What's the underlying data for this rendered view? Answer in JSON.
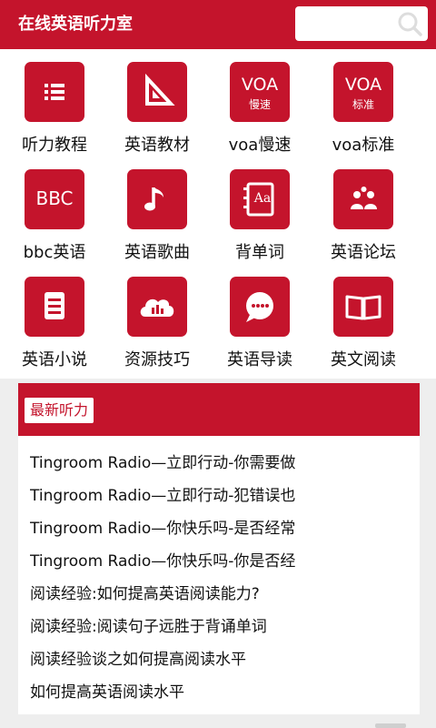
{
  "header": {
    "title": "在线英语听力室",
    "search_placeholder": "",
    "search_icon": "search-icon"
  },
  "menu": [
    {
      "label": "听力教程",
      "icon": "list-icon"
    },
    {
      "label": "英语教材",
      "icon": "triangle-ruler-icon"
    },
    {
      "label": "voa慢速",
      "icon": "voa-slow-icon",
      "badge": "VOA",
      "sub": "慢速"
    },
    {
      "label": "voa标准",
      "icon": "voa-standard-icon",
      "badge": "VOA",
      "sub": "标准"
    },
    {
      "label": "bbc英语",
      "icon": "bbc-icon",
      "badge": "BBC"
    },
    {
      "label": "英语歌曲",
      "icon": "music-note-icon"
    },
    {
      "label": "背单词",
      "icon": "dictionary-icon",
      "badge": "Aa"
    },
    {
      "label": "英语论坛",
      "icon": "forum-people-icon"
    },
    {
      "label": "英语小说",
      "icon": "document-icon"
    },
    {
      "label": "资源技巧",
      "icon": "cloud-chart-icon"
    },
    {
      "label": "英语导读",
      "icon": "chat-bubble-icon"
    },
    {
      "label": "英文阅读",
      "icon": "open-book-icon"
    }
  ],
  "latest": {
    "tab_label": "最新听力",
    "items": [
      "Tingroom Radio—立即行动-你需要做",
      "Tingroom Radio—立即行动-犯错误也",
      "Tingroom Radio—你快乐吗-是否经常",
      "Tingroom Radio—你快乐吗-你是否经",
      "阅读经验:如何提高英语阅读能力?",
      "阅读经验:阅读句子远胜于背诵单词",
      "阅读经验谈之如何提高阅读水平",
      "如何提高英语阅读水平"
    ]
  },
  "colors": {
    "brand_red": "#c4142c",
    "background": "#eeeeee",
    "text": "#111111"
  }
}
